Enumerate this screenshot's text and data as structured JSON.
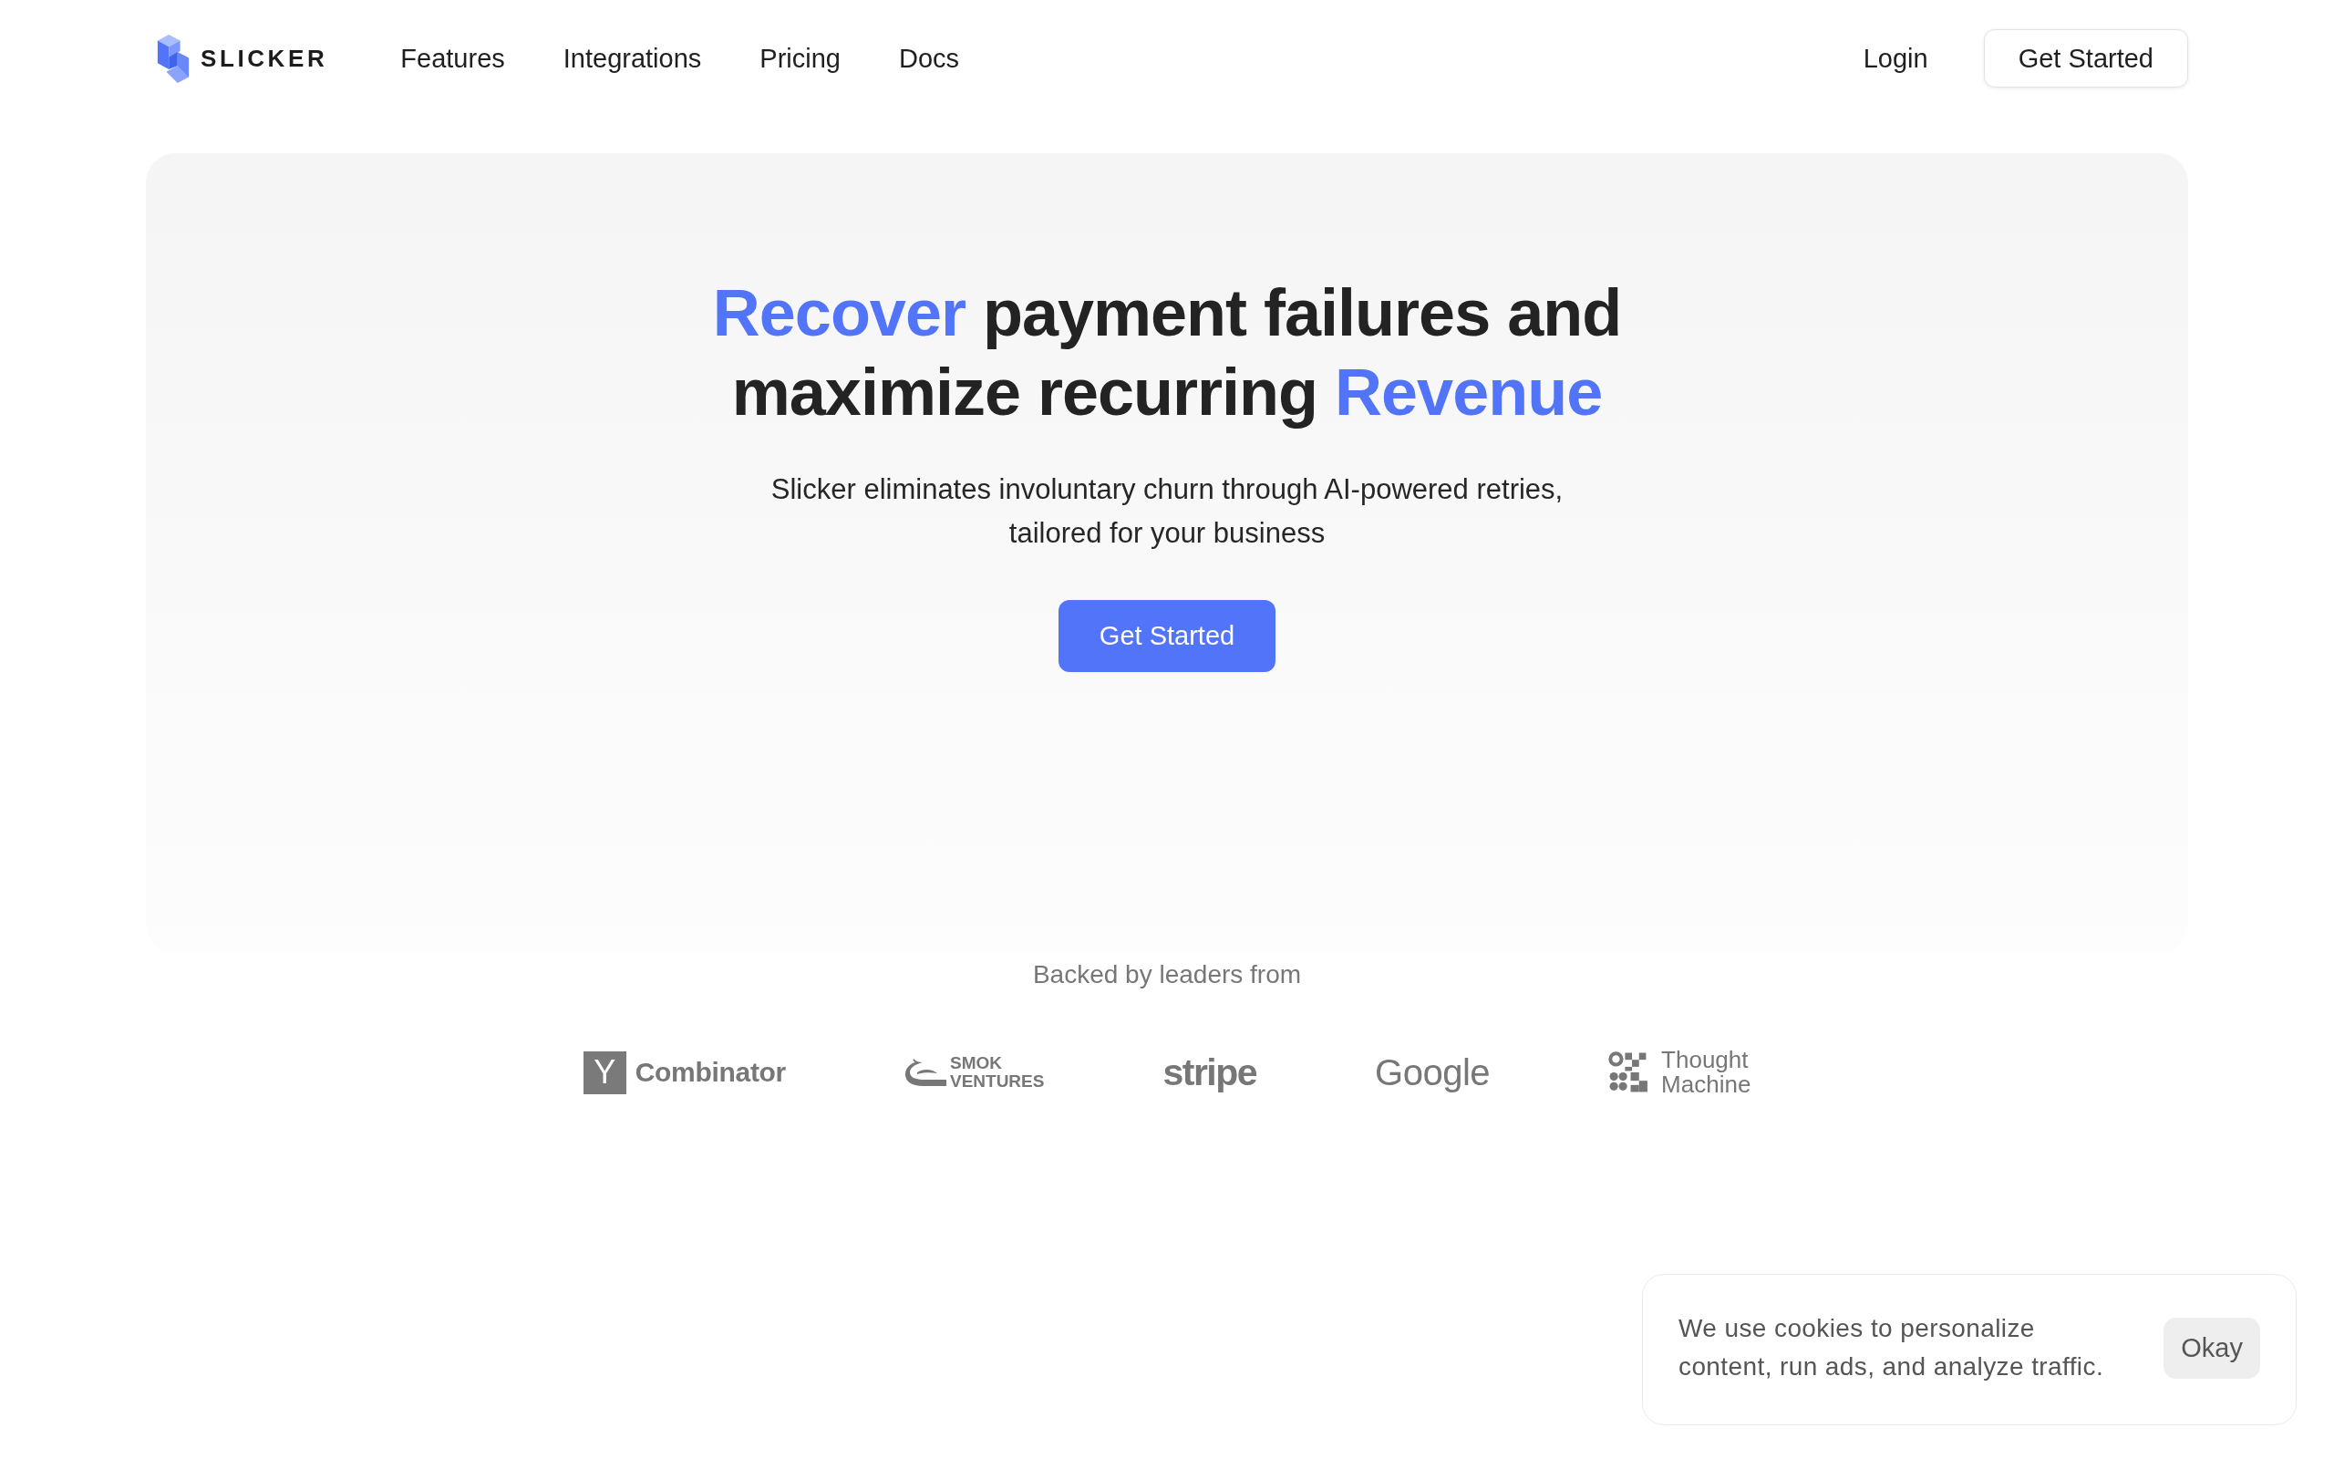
{
  "header": {
    "brand": "SLICKER",
    "nav_links": [
      "Features",
      "Integrations",
      "Pricing",
      "Docs"
    ],
    "login": "Login",
    "cta_button": "Get Started"
  },
  "hero": {
    "heading_lines": [
      [
        {
          "text": "Recover",
          "highlight": true
        },
        {
          "text": "payment failures and",
          "highlight": false
        }
      ],
      [
        {
          "text": "maximize recurring",
          "highlight": false
        },
        {
          "text": "Revenue",
          "highlight": true
        }
      ]
    ],
    "subtitle_lines": [
      "Slicker eliminates involuntary churn through AI-powered retries,",
      "tailored for your business"
    ],
    "button": "Get Started"
  },
  "backers": {
    "caption": "Backed by leaders from",
    "logos": [
      {
        "kind": "letter-square",
        "mark": "Y",
        "lines": [
          "Combinator"
        ]
      },
      {
        "kind": "swirl",
        "lines": [
          "SMOK",
          "VENTURES"
        ]
      },
      {
        "kind": "wordmark-bold",
        "lines": [
          "stripe"
        ]
      },
      {
        "kind": "wordmark",
        "lines": [
          "Google"
        ]
      },
      {
        "kind": "grid",
        "lines": [
          "Thought",
          "Machine"
        ]
      }
    ]
  },
  "cookie_banner": {
    "text_lines": [
      "We use cookies to personalize",
      "content, run ads, and analyze traffic."
    ],
    "button": "Okay"
  }
}
